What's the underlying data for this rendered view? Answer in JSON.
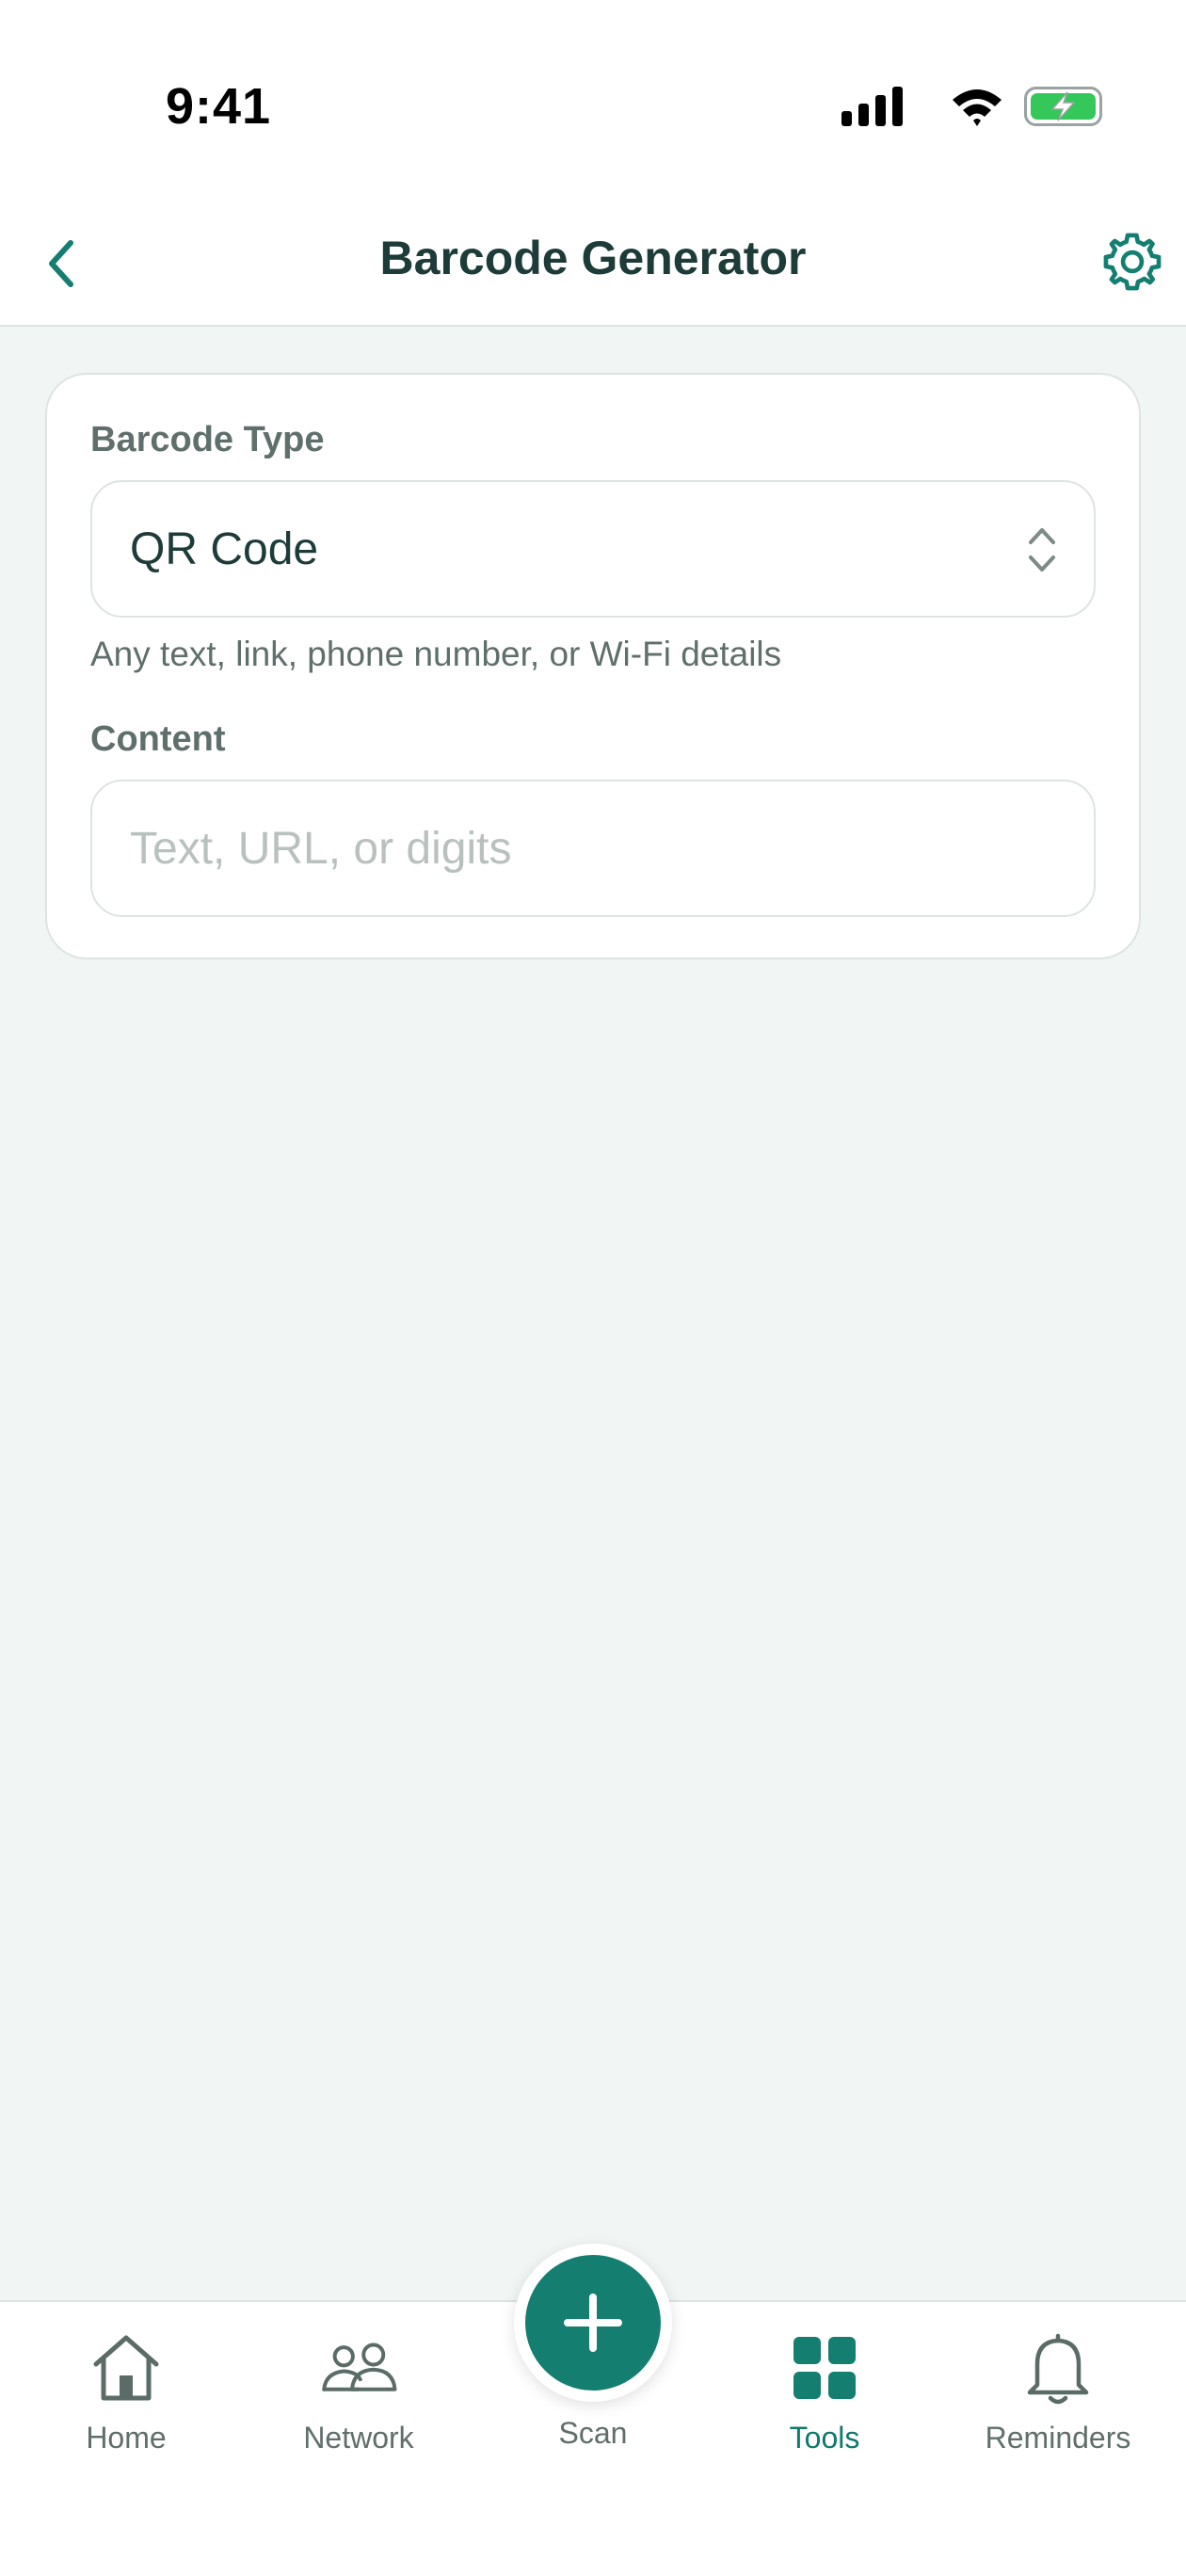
{
  "status_bar": {
    "time": "9:41"
  },
  "header": {
    "title": "Barcode Generator",
    "back_icon": "chevron-left-icon",
    "settings_icon": "gear-icon"
  },
  "form": {
    "barcode_type_label": "Barcode Type",
    "barcode_type_value": "QR Code",
    "barcode_type_hint": "Any text, link, phone number, or Wi-Fi details",
    "content_label": "Content",
    "content_placeholder": "Text, URL, or digits",
    "content_value": ""
  },
  "tab_bar": {
    "items": [
      {
        "label": "Home",
        "icon": "house-icon",
        "active": false
      },
      {
        "label": "Network",
        "icon": "people-icon",
        "active": false
      },
      {
        "label": "Scan",
        "icon": "plus-icon",
        "active": false
      },
      {
        "label": "Tools",
        "icon": "grid-icon",
        "active": true
      },
      {
        "label": "Reminders",
        "icon": "bell-icon",
        "active": false
      }
    ]
  },
  "colors": {
    "accent": "#147f70",
    "background": "#f1f5f4",
    "text_primary": "#1d3b38",
    "text_secondary": "#5f6f6c",
    "battery_fill": "#34c759"
  }
}
